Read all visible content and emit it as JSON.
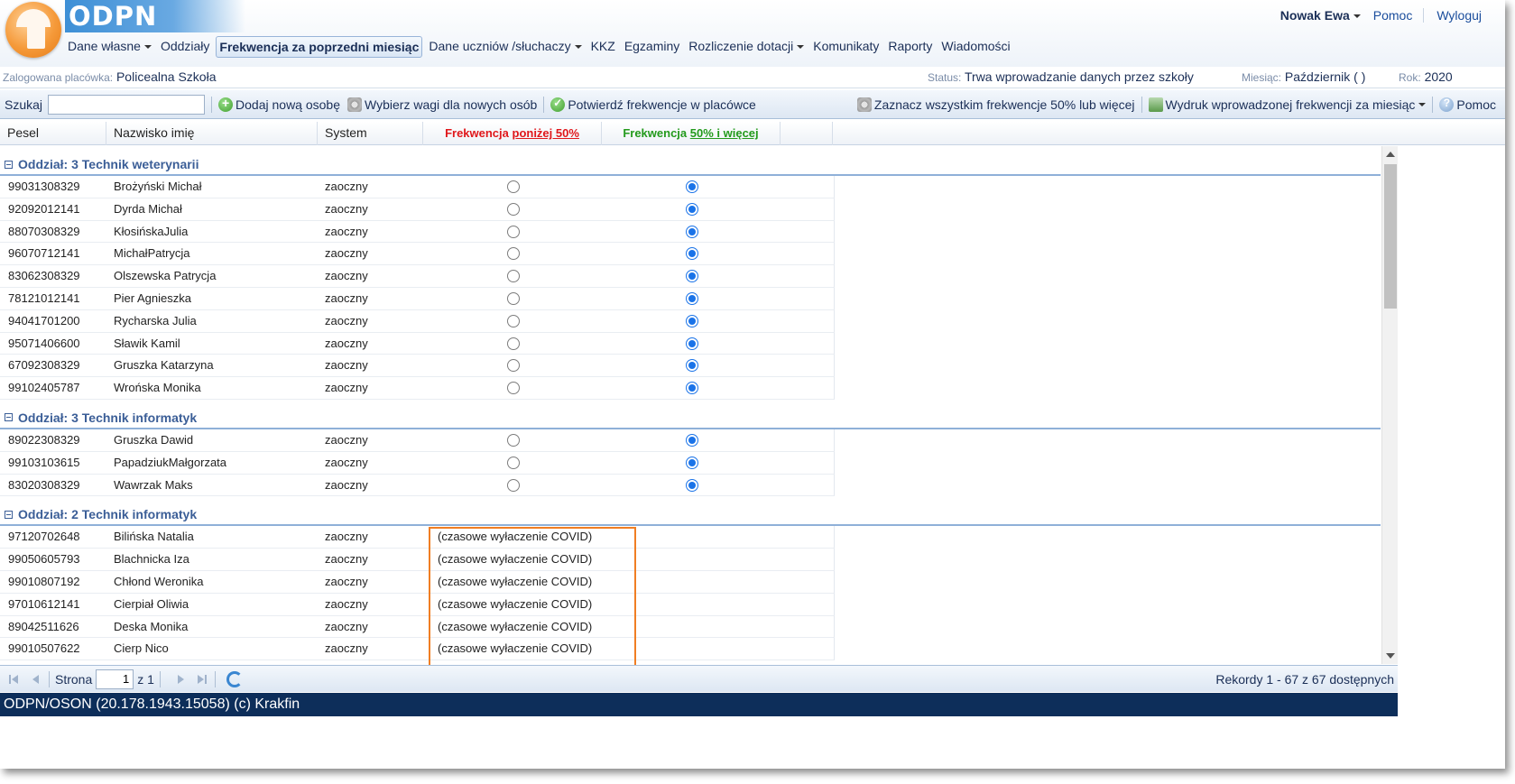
{
  "header": {
    "logo_text": "ODPN",
    "user_name": "Nowak Ewa",
    "help_link": "Pomoc",
    "logout_link": "Wyloguj"
  },
  "menu": [
    {
      "label": "Dane własne",
      "dropdown": true,
      "active": false
    },
    {
      "label": "Oddziały",
      "dropdown": false,
      "active": false
    },
    {
      "label": "Frekwencja za poprzedni miesiąc",
      "dropdown": false,
      "active": true
    },
    {
      "label": "Dane uczniów /słuchaczy",
      "dropdown": true,
      "active": false
    },
    {
      "label": "KKZ",
      "dropdown": false,
      "active": false
    },
    {
      "label": "Egzaminy",
      "dropdown": false,
      "active": false
    },
    {
      "label": "Rozliczenie dotacji",
      "dropdown": true,
      "active": false
    },
    {
      "label": "Komunikaty",
      "dropdown": false,
      "active": false
    },
    {
      "label": "Raporty",
      "dropdown": false,
      "active": false
    },
    {
      "label": "Wiadomości",
      "dropdown": false,
      "active": false
    }
  ],
  "info": {
    "placowka_label": "Zalogowana placówka:",
    "placowka_value": "Policealna Szkoła",
    "status_label": "Status:",
    "status_value": "Trwa wprowadzanie danych przez szkoły",
    "miesiac_label": "Miesiąc:",
    "miesiac_value": "Październik ( )",
    "rok_label": "Rok:",
    "rok_value": "2020"
  },
  "toolbar": {
    "search_label": "Szukaj",
    "search_value": "",
    "add_person": "Dodaj nową osobę",
    "choose_weights": "Wybierz wagi dla nowych osób",
    "confirm_attendance": "Potwierdź frekwencje w placówce",
    "mark_all": "Zaznacz wszystkim frekwencje 50% lub więcej",
    "print_attendance": "Wydruk wprowadzonej frekwencji za miesiąc",
    "help": "Pomoc"
  },
  "columns": {
    "pesel": "Pesel",
    "name": "Nazwisko imię",
    "system": "System",
    "below_prefix": "Frekwencja ",
    "below_link": "poniżej 50%",
    "above_prefix": "Frekwencja ",
    "above_link": "50% i więcej"
  },
  "groups": [
    {
      "title": "Oddział: 3 Technik weterynarii",
      "rows": [
        {
          "pesel": "99031308329",
          "name": "Brożyński Michał",
          "system": "zaoczny",
          "attendance": "above"
        },
        {
          "pesel": "92092012141",
          "name": "Dyrda Michał",
          "system": "zaoczny",
          "attendance": "above"
        },
        {
          "pesel": "88070308329",
          "name": "KłosińskaJulia",
          "system": "zaoczny",
          "attendance": "above"
        },
        {
          "pesel": "96070712141",
          "name": "MichałPatrycja",
          "system": "zaoczny",
          "attendance": "above"
        },
        {
          "pesel": "83062308329",
          "name": "Olszewska Patrycja",
          "system": "zaoczny",
          "attendance": "above"
        },
        {
          "pesel": "78121012141",
          "name": "Pier Agnieszka",
          "system": "zaoczny",
          "attendance": "above"
        },
        {
          "pesel": "94041701200",
          "name": "Rycharska Julia",
          "system": "zaoczny",
          "attendance": "above"
        },
        {
          "pesel": "95071406600",
          "name": "Sławik Kamil",
          "system": "zaoczny",
          "attendance": "above"
        },
        {
          "pesel": "67092308329",
          "name": "Gruszka Katarzyna",
          "system": "zaoczny",
          "attendance": "above"
        },
        {
          "pesel": "99102405787",
          "name": "Wrońska Monika",
          "system": "zaoczny",
          "attendance": "above"
        }
      ]
    },
    {
      "title": "Oddział: 3 Technik informatyk",
      "rows": [
        {
          "pesel": "89022308329",
          "name": "Gruszka Dawid",
          "system": "zaoczny",
          "attendance": "above"
        },
        {
          "pesel": "99103103615",
          "name": "PapadziukMałgorzata",
          "system": "zaoczny",
          "attendance": "above"
        },
        {
          "pesel": "83020308329",
          "name": "Wawrzak Maks",
          "system": "zaoczny",
          "attendance": "above"
        }
      ]
    },
    {
      "title": "Oddział: 2 Technik informatyk",
      "rows": [
        {
          "pesel": "97120702648",
          "name": "Bilińska Natalia",
          "system": "zaoczny",
          "attendance": "covid"
        },
        {
          "pesel": "99050605793",
          "name": "Blachnicka Iza",
          "system": "zaoczny",
          "attendance": "covid"
        },
        {
          "pesel": "99010807192",
          "name": "Chłond Weronika",
          "system": "zaoczny",
          "attendance": "covid"
        },
        {
          "pesel": "97010612141",
          "name": "Cierpiał Oliwia",
          "system": "zaoczny",
          "attendance": "covid"
        },
        {
          "pesel": "89042511626",
          "name": "Deska Monika",
          "system": "zaoczny",
          "attendance": "covid"
        },
        {
          "pesel": "99010507622",
          "name": "Cierp Nico",
          "system": "zaoczny",
          "attendance": "covid"
        }
      ]
    }
  ],
  "covid_text": "(czasowe wyłaczenie COVID)",
  "pager": {
    "page_label": "Strona",
    "page_value": "1",
    "of_label": "z 1",
    "records": "Rekordy 1 - 67 z 67 dostępnych"
  },
  "footer": {
    "text": "ODPN/OSON (20.178.1943.15058) (c) Krakfin"
  },
  "colors": {
    "below": "#e0171b",
    "above": "#239a1c",
    "footer_bg": "#0d2e5a",
    "highlight": "#f07e23"
  }
}
